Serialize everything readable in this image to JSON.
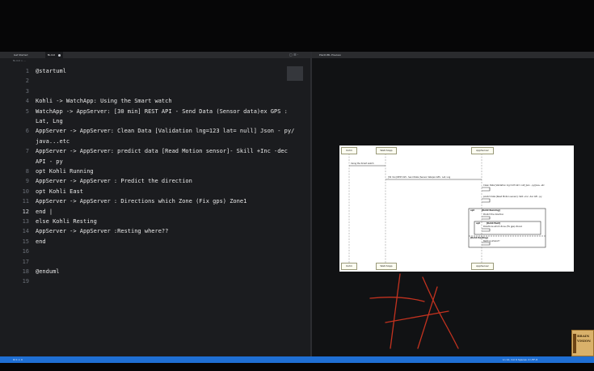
{
  "tabs": [
    {
      "label": "Get Started",
      "active": false
    },
    {
      "label": "fb.md",
      "active": true,
      "modified": true
    },
    {
      "label": "PlantUML Preview",
      "active": false
    }
  ],
  "breadcrumb": "fb.md > ...",
  "code_lines": [
    {
      "num": "1",
      "text": "@startuml"
    },
    {
      "num": "2",
      "text": ""
    },
    {
      "num": "3",
      "text": ""
    },
    {
      "num": "4",
      "text": "Kohli -> WatchApp:  Using the Smart watch"
    },
    {
      "num": "5",
      "text": "WatchApp -> AppServer: [30 min] REST API - Send Data (Sensor data)ex GPS :"
    },
    {
      "num": "",
      "text": "Lat, Lng"
    },
    {
      "num": "6",
      "text": "AppServer -> AppServer: Clean Data [Validation lng=123 lat= null] Json - py/"
    },
    {
      "num": "",
      "text": "java...etc"
    },
    {
      "num": "7",
      "text": "AppServer -> AppServer: predict data [Read Motion sensor]- Skill +Inc  -dec"
    },
    {
      "num": "",
      "text": "API - py"
    },
    {
      "num": "8",
      "text": "opt Kohli Running"
    },
    {
      "num": "9",
      "text": "AppServer -> AppServer : Predict the direction"
    },
    {
      "num": "10",
      "text": "opt Kohli East"
    },
    {
      "num": "11",
      "text": "AppServer -> AppServer : Directions which Zone  (Fix gps) Zone1"
    },
    {
      "num": "12",
      "text": "end |",
      "current": true
    },
    {
      "num": "13",
      "text": "else Kohli Resting"
    },
    {
      "num": "14",
      "text": "AppServer -> AppServer :Resting where??"
    },
    {
      "num": "15",
      "text": "end"
    },
    {
      "num": "16",
      "text": ""
    },
    {
      "num": "17",
      "text": ""
    },
    {
      "num": "18",
      "text": "@enduml"
    },
    {
      "num": "19",
      "text": ""
    }
  ],
  "uml": {
    "participants": [
      "Kohli",
      "WatchApp",
      "AppServer"
    ],
    "messages": [
      "Using the Smart watch",
      "[30 min] REST API - Send Data (Sensor data)ex GPS : Lat, Lng",
      "Clean Data [Validation lng=123 lat= null] Json - py/java...etc",
      "predict data [Read Motion sensor]- Skill +Inc -dec API - py",
      "Predict the direction",
      "Directions which Zone (Fix gps) Zone1",
      "Resting where??"
    ],
    "frames": {
      "opt_outer": "opt",
      "opt_outer_guard": "[Kohli Running]",
      "opt_inner": "opt",
      "opt_inner_guard": "[Kohli East]",
      "else_guard": "[Kohli Resting]"
    }
  },
  "statusbar": {
    "left": "⊗ 0 ⚠ 0",
    "right": "Ln 12, Col 6  Spaces: 4  UTF-8"
  },
  "logo": {
    "line1": "BRAIN",
    "line2": "VISION"
  },
  "colors": {
    "statusbar": "#1f6fd4",
    "editor_bg": "#1b1c1f",
    "handwriting": "#c2321f"
  }
}
